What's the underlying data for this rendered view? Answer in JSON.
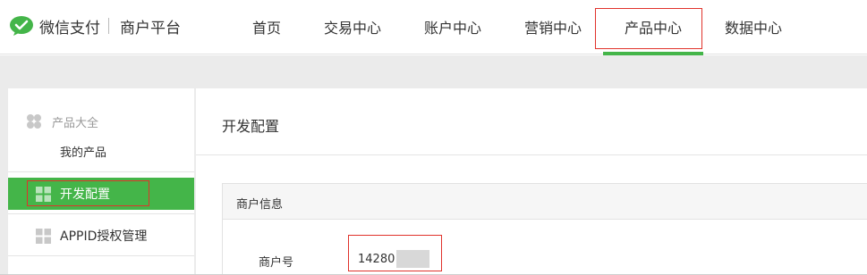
{
  "brand": {
    "name": "微信支付",
    "subtitle": "商户平台",
    "accent": "#44b549"
  },
  "nav": {
    "items": [
      "首页",
      "交易中心",
      "账户中心",
      "营销中心",
      "产品中心",
      "数据中心"
    ],
    "active": "产品中心"
  },
  "sidebar": {
    "group_title": "产品大全",
    "my_products": "我的产品",
    "items": [
      {
        "label": "开发配置",
        "active": true
      },
      {
        "label": "APPID授权管理",
        "active": false
      }
    ]
  },
  "main": {
    "title": "开发配置",
    "panel": {
      "title": "商户信息",
      "fields": [
        {
          "label": "商户号",
          "value": "14280"
        }
      ]
    }
  },
  "colors": {
    "highlight_box": "#e0322b",
    "active_bg": "#44b549",
    "page_bg": "#ebebeb"
  }
}
